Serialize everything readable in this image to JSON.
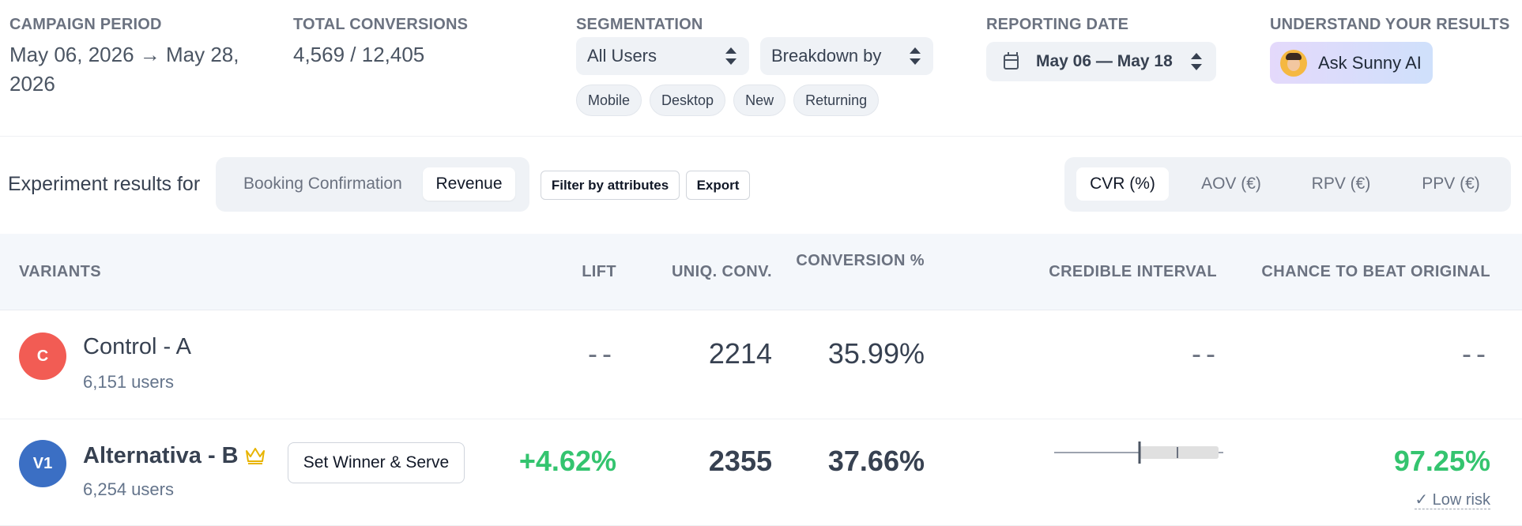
{
  "summary": {
    "campaign_period": {
      "label": "CAMPAIGN PERIOD",
      "value": "May 06, 2026 → May 28, 2026"
    },
    "total_conversions": {
      "label": "TOTAL CONVERSIONS",
      "value": "4,569 / 12,405"
    },
    "segmentation": {
      "label": "SEGMENTATION",
      "users_select": "All Users",
      "breakdown_select": "Breakdown by",
      "chips": [
        "Mobile",
        "Desktop",
        "New",
        "Returning"
      ]
    },
    "reporting_date": {
      "label": "REPORTING DATE",
      "value": "May 06 — May 18"
    },
    "understand": {
      "label": "UNDERSTAND YOUR RESULTS",
      "ai_button": "Ask Sunny AI"
    }
  },
  "toolbar": {
    "experiment_label": "Experiment results for",
    "goals": [
      "Booking Confirmation",
      "Revenue"
    ],
    "active_goal": "Revenue",
    "filter_button": "Filter by attributes",
    "export_button": "Export",
    "metrics": [
      "CVR (%)",
      "AOV (€)",
      "RPV (€)",
      "PPV (€)"
    ],
    "active_metric": "CVR (%)"
  },
  "table": {
    "headers": {
      "variants": "VARIANTS",
      "lift": "LIFT",
      "uniq_conv": "UNIQ. CONV.",
      "conversion": "CONVERSION %",
      "credible_interval": "CREDIBLE INTERVAL",
      "chance_to_beat": "CHANCE TO BEAT ORIGINAL"
    },
    "rows": [
      {
        "badge": "C",
        "name": "Control - A",
        "users": "6,151 users",
        "lift": "--",
        "uniq_conv": "2214",
        "conversion": "35.99%",
        "credible_interval": "--",
        "chance_to_beat": "--"
      },
      {
        "badge": "V1",
        "name": "Alternativa - B",
        "users": "6,254 users",
        "winner_button": "Set Winner & Serve",
        "lift": "+4.62%",
        "uniq_conv": "2355",
        "conversion": "37.66%",
        "chance_to_beat": "97.25%",
        "risk": "✓ Low risk"
      }
    ]
  },
  "colors": {
    "positive": "#34c46f",
    "control_badge": "#f25c54",
    "variant_badge": "#3b6fc4",
    "header_bg": "#f4f7fb",
    "pill_bg": "#eff2f6",
    "crown": "#e8b400"
  },
  "icons": {
    "date": "calendar-icon",
    "select": "chevron-up-down-icon",
    "ai": "sunny-ai-avatar",
    "winner": "crown-icon"
  }
}
